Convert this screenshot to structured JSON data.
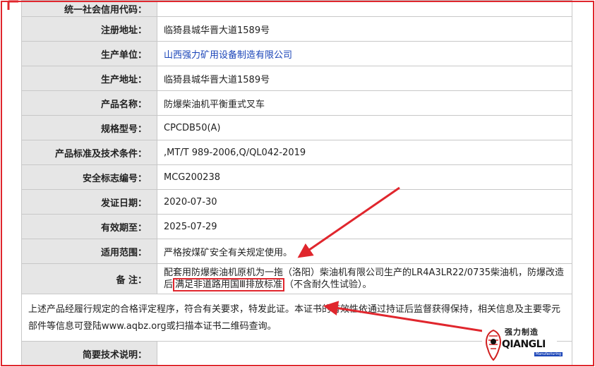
{
  "rows": [
    {
      "label": "统一社会信用代码：",
      "value": ""
    },
    {
      "label": "注册地址：",
      "value": "临猗县城华晋大道1589号"
    },
    {
      "label": "生产单位：",
      "value": "山西强力矿用设备制造有限公司"
    },
    {
      "label": "生产地址：",
      "value": "临猗县城华晋大道1589号"
    },
    {
      "label": "产品名称：",
      "value": "防爆柴油机平衡重式叉车"
    },
    {
      "label": "规格型号：",
      "value": "CPCDB50(A)"
    },
    {
      "label": "产品标准及技术条件：",
      "value": ",MT/T 989-2006,Q/QL042-2019"
    },
    {
      "label": "安全标志编号：",
      "value": "MCG200238"
    },
    {
      "label": "发证日期：",
      "value": "2020-07-30"
    },
    {
      "label": "有效期至：",
      "value": "2025-07-29"
    },
    {
      "label": "适用范围：",
      "value": "严格按煤矿安全有关规定使用。"
    }
  ],
  "remark": {
    "label": "备 注：",
    "text_before": "配套用防爆柴油机原机为一拖（洛阳）柴油机有限公司生产的LR4A3LR22/0735柴油机，防爆改造后",
    "highlight": "满足非道路用国Ⅲ排放标准",
    "text_after": "（不含耐久性试验）。"
  },
  "statement": "上述产品经履行规定的合格评定程序，符合有关要求，特发此证。本证书的有效性依通过持证后监督获得保持，相关信息及主要零元部件等信息可登陆www.aqbz.org或扫描本证书二维码查询。",
  "tech_label": "简要技术说明：",
  "logo": {
    "zh": "强力制造",
    "en": "QIANGLI",
    "sub": "Manufacturing"
  },
  "colors": {
    "annotation_red": "#e0262d",
    "link_blue": "#1a44b8",
    "label_bg": "#e6e6e6"
  }
}
